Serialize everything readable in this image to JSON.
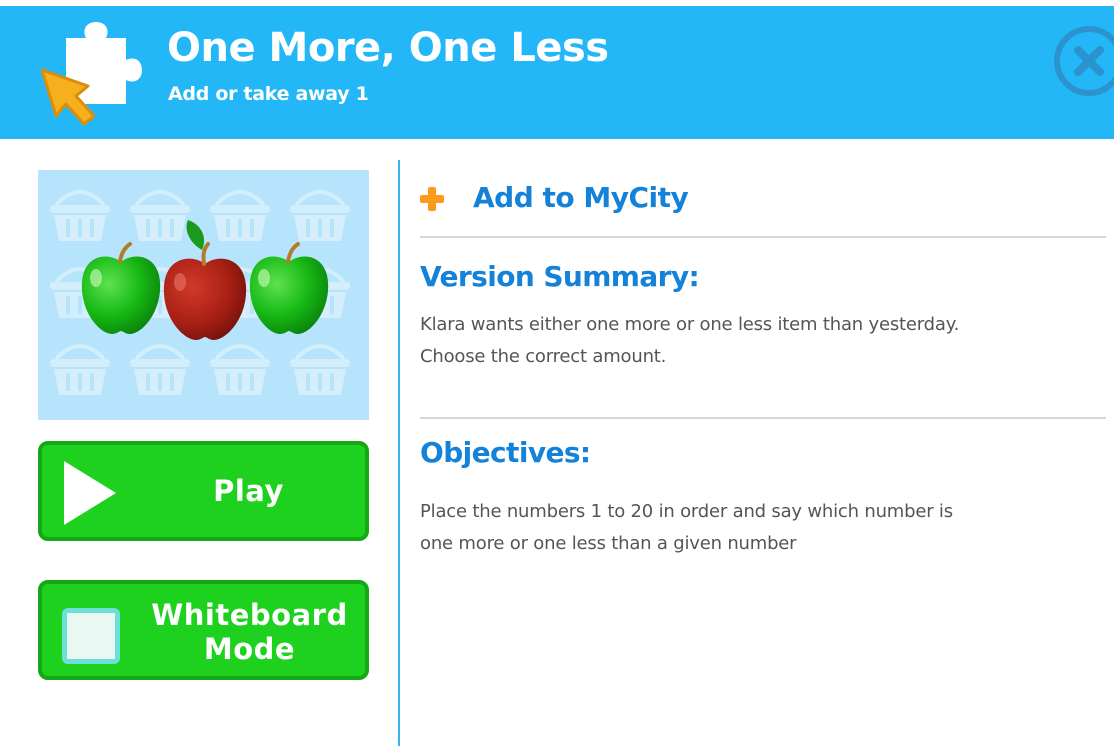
{
  "header": {
    "title": "One More, One Less",
    "subtitle": "Add or take away 1",
    "logo_icon": "puzzle-pointer-icon",
    "close_icon": "close-icon",
    "background_color": "#23b7f7"
  },
  "activity": {
    "thumbnail_icon": "apples-baskets-thumbnail",
    "play_label": "Play",
    "play_icon": "play-icon",
    "whiteboard_label_line1": "Whiteboard",
    "whiteboard_label_line2": "Mode",
    "whiteboard_icon": "whiteboard-icon",
    "button_color": "#1ed11e"
  },
  "details": {
    "add_label": "Add to MyCity",
    "add_icon": "plus-icon",
    "summary_title": "Version Summary:",
    "summary_line1": "Klara wants either one more or one less item than yesterday.",
    "summary_line2": "Choose the correct amount.",
    "objectives_title": "Objectives:",
    "objectives_line1": "Place the numbers 1 to 20 in order and say which number is",
    "objectives_line2": "one more or one less than a given number",
    "accent_color": "#1482d8"
  }
}
